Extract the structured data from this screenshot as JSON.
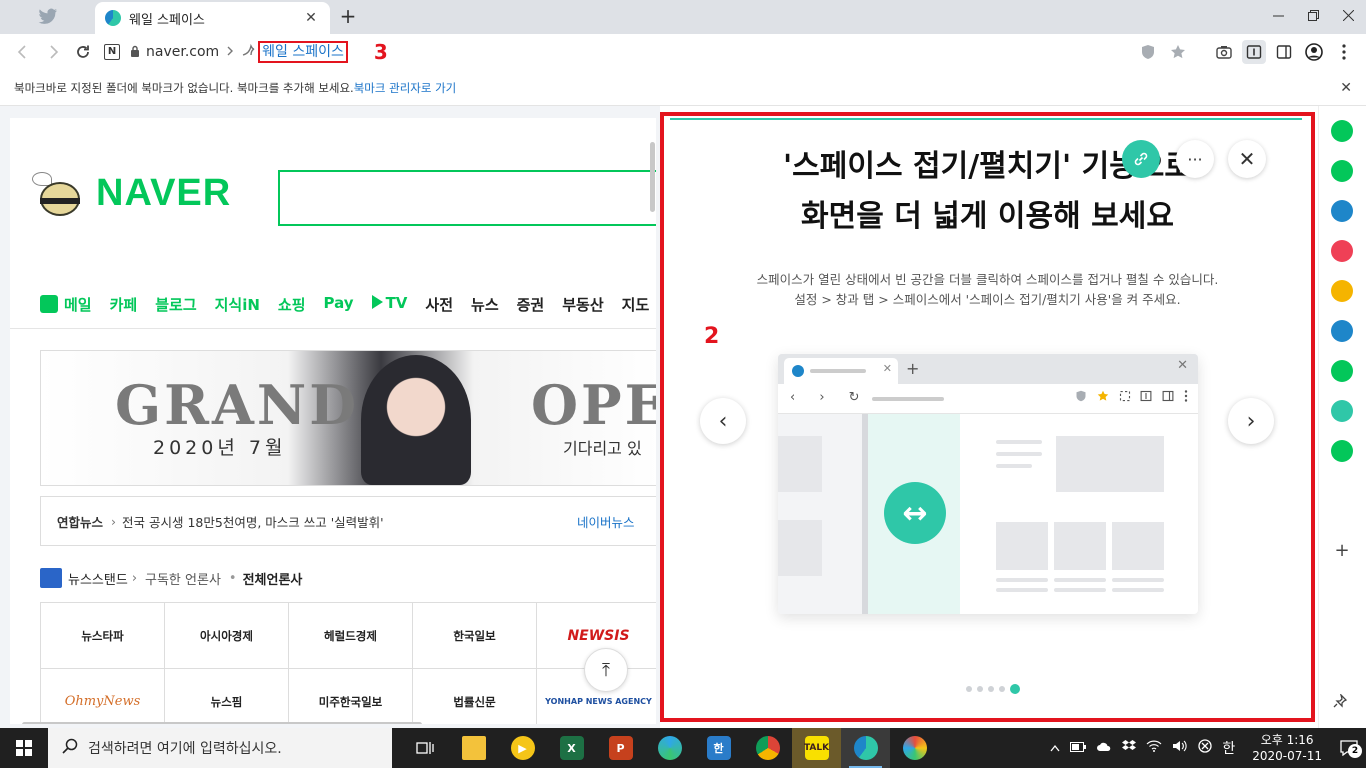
{
  "browser": {
    "tab_title": "웨일 스페이스",
    "tab_close": "✕",
    "new_tab": "+",
    "url": "naver.com",
    "breadcrumb_link": "웨일 스페이스",
    "annotation_3": "3",
    "lock_icon": "lock-icon"
  },
  "bookmark_bar": {
    "message": "북마크바로 지정된 폴더에 북마크가 없습니다. 북마크를 추가해 보세요.",
    "manager_link": "북마크 관리자로 가기",
    "close": "✕"
  },
  "naver": {
    "logo_text": "NAVER",
    "menu": [
      {
        "label": "메일",
        "color": "green"
      },
      {
        "label": "카페",
        "color": "green"
      },
      {
        "label": "블로그",
        "color": "green"
      },
      {
        "label": "지식iN",
        "color": "green"
      },
      {
        "label": "쇼핑",
        "color": "green"
      },
      {
        "label": "Pay",
        "color": "green"
      },
      {
        "label": "TV",
        "color": "green"
      },
      {
        "label": "사전",
        "color": "black"
      },
      {
        "label": "뉴스",
        "color": "black"
      },
      {
        "label": "증권",
        "color": "black"
      },
      {
        "label": "부동산",
        "color": "black"
      },
      {
        "label": "지도",
        "color": "black"
      }
    ],
    "banner": {
      "grand": "GRAND",
      "date": "2020년 7월",
      "ope": "OPE",
      "wait": "기다리고 있"
    },
    "newsline": {
      "source": "연합뉴스",
      "arrow": "›",
      "headline": "전국 공시생 18만5천여명, 마스크 쓰고 '실력발휘'",
      "naver_news": "네이버뉴스"
    },
    "newsstand": {
      "title": "뉴스스탠드",
      "arrow": "›",
      "subscribed": "구독한 언론사",
      "dot": "•",
      "all": "전체언론사"
    },
    "press": [
      {
        "name": "뉴스타파",
        "style": ""
      },
      {
        "name": "아시아경제",
        "style": ""
      },
      {
        "name": "헤럴드경제",
        "style": ""
      },
      {
        "name": "한국일보",
        "style": ""
      },
      {
        "name": "NEWSIS",
        "style": "red"
      },
      {
        "name": "OhmyNews",
        "style": "omy"
      },
      {
        "name": "뉴스핌",
        "style": ""
      },
      {
        "name": "미주한국일보",
        "style": ""
      },
      {
        "name": "법률신문",
        "style": ""
      },
      {
        "name": "YONHAP NEWS AGENCY",
        "style": ""
      }
    ],
    "top_button": "⤒"
  },
  "space_panel": {
    "title_line1": "'스페이스 접기/펼치기' 기능으로",
    "title_line2": "화면을 더 넓게 이용해 보세요",
    "desc_line1": "스페이스가 열린 상태에서 빈 공간을 더블 클릭하여 스페이스를 접거나 펼칠 수 있습니다.",
    "desc_line2": "설정 > 창과 탭 > 스페이스에서 '스페이스 접기/펼치기 사용'을 켜 주세요.",
    "annotation_2": "2",
    "close": "✕",
    "more": "···",
    "prev": "‹",
    "next": "›",
    "illus_tab_close": "✕",
    "illus_plus": "+",
    "illus_close": "✕",
    "illus_nav": "‹ › ↻",
    "illus_arrow": "↔",
    "carousel_total": 5,
    "carousel_current": 5
  },
  "sidebar": {
    "items": [
      {
        "name": "sidebar-green-circle-icon",
        "color": "#03c75a"
      },
      {
        "name": "sidebar-alarm-icon",
        "color": "#03c75a"
      },
      {
        "name": "sidebar-calendar-icon",
        "color": "#1e86c9"
      },
      {
        "name": "sidebar-pocket-icon",
        "color": "#ef4056"
      },
      {
        "name": "sidebar-star-icon",
        "color": "#f5b400"
      },
      {
        "name": "sidebar-translate-icon",
        "color": "#1e86c9"
      },
      {
        "name": "sidebar-line-icon",
        "color": "#03c75a"
      },
      {
        "name": "sidebar-player-icon",
        "color": "#2fc7a8"
      },
      {
        "name": "sidebar-webtoon-icon",
        "color": "#03c75a"
      }
    ],
    "add": "+"
  },
  "taskbar": {
    "search_placeholder": "검색하려면 여기에 입력하십시오.",
    "time": "오후 1:16",
    "date": "2020-07-11",
    "ime": "한",
    "notifications": "2"
  }
}
